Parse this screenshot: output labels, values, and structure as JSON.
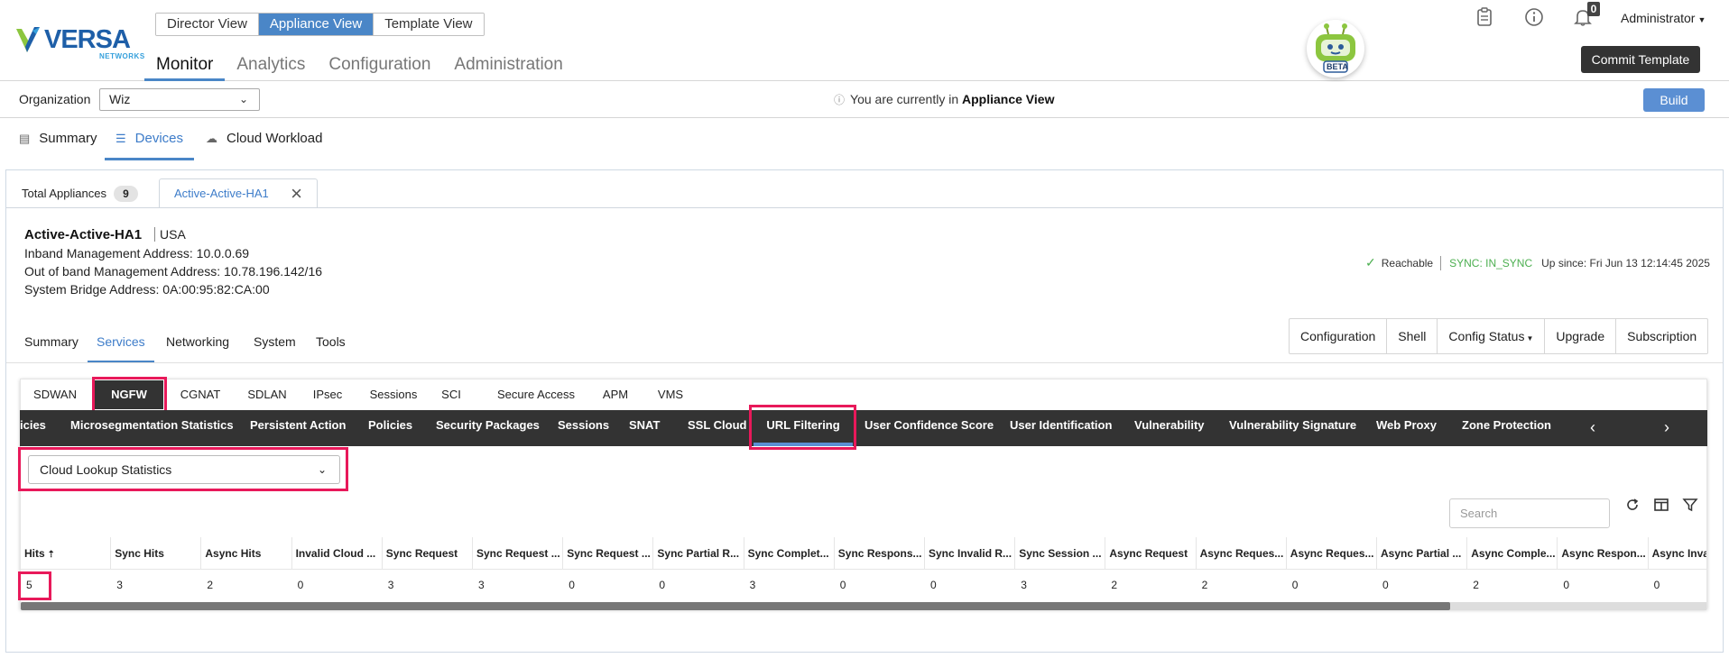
{
  "header": {
    "logo_text": "VERSA",
    "logo_sub": "NETWORKS",
    "view_switch": [
      {
        "label": "Director View",
        "active": false
      },
      {
        "label": "Appliance View",
        "active": true
      },
      {
        "label": "Template View",
        "active": false
      }
    ],
    "main_nav": [
      {
        "label": "Monitor",
        "active": true
      },
      {
        "label": "Analytics",
        "active": false
      },
      {
        "label": "Configuration",
        "active": false
      },
      {
        "label": "Administration",
        "active": false
      }
    ],
    "bot_label": "BETA",
    "notification_count": "0",
    "user": "Administrator",
    "commit_button": "Commit Template"
  },
  "org_bar": {
    "label": "Organization",
    "selected": "Wiz",
    "message_prefix": "You are currently in",
    "message_view": "Appliance View",
    "build_button": "Build"
  },
  "sub_nav": [
    {
      "label": "Summary",
      "icon": "summary-icon",
      "active": false
    },
    {
      "label": "Devices",
      "icon": "devices-icon",
      "active": true
    },
    {
      "label": "Cloud Workload",
      "icon": "cloud-icon",
      "active": false
    }
  ],
  "tabs": {
    "total_label": "Total Appliances",
    "total_count": "9",
    "device_tab": "Active-Active-HA1"
  },
  "device": {
    "name": "Active-Active-HA1",
    "country": "USA",
    "inband": "Inband Management Address: 10.0.0.69",
    "oob": "Out of band Management Address: 10.78.196.142/16",
    "bridge": "System Bridge Address: 0A:00:95:82:CA:00",
    "status": "Reachable",
    "sync": "SYNC: IN_SYNC",
    "uptime": "Up since: Fri Jun 13 12:14:45 2025"
  },
  "service_nav": [
    {
      "label": "Summary",
      "active": false
    },
    {
      "label": "Services",
      "active": true
    },
    {
      "label": "Networking",
      "active": false
    },
    {
      "label": "System",
      "active": false
    },
    {
      "label": "Tools",
      "active": false
    }
  ],
  "actions": [
    "Configuration",
    "Shell",
    "Config Status",
    "Upgrade",
    "Subscription"
  ],
  "categories": [
    {
      "label": "SDWAN",
      "active": false
    },
    {
      "label": "NGFW",
      "active": true
    },
    {
      "label": "CGNAT",
      "active": false
    },
    {
      "label": "SDLAN",
      "active": false
    },
    {
      "label": "IPsec",
      "active": false
    },
    {
      "label": "Sessions",
      "active": false
    },
    {
      "label": "SCI",
      "active": false
    },
    {
      "label": "Secure Access",
      "active": false
    },
    {
      "label": "APM",
      "active": false
    },
    {
      "label": "VMS",
      "active": false
    }
  ],
  "features": [
    {
      "label": "icies",
      "active": false
    },
    {
      "label": "Microsegmentation Statistics",
      "active": false
    },
    {
      "label": "Persistent Action",
      "active": false
    },
    {
      "label": "Policies",
      "active": false
    },
    {
      "label": "Security Packages",
      "active": false
    },
    {
      "label": "Sessions",
      "active": false
    },
    {
      "label": "SNAT",
      "active": false
    },
    {
      "label": "SSL Cloud",
      "active": false
    },
    {
      "label": "URL Filtering",
      "active": true
    },
    {
      "label": "User Confidence Score",
      "active": false
    },
    {
      "label": "User Identification",
      "active": false
    },
    {
      "label": "Vulnerability",
      "active": false
    },
    {
      "label": "Vulnerability Signature",
      "active": false
    },
    {
      "label": "Web Proxy",
      "active": false
    },
    {
      "label": "Zone Protection",
      "active": false
    }
  ],
  "view_select": "Cloud Lookup Statistics",
  "search_placeholder": "Search",
  "table": {
    "columns": [
      "Hits",
      "Sync Hits",
      "Async Hits",
      "Invalid Cloud ...",
      "Sync Request",
      "Sync Request ...",
      "Sync Request ...",
      "Sync Partial R...",
      "Sync Complet...",
      "Sync Respons...",
      "Sync Invalid R...",
      "Sync Session ...",
      "Async Request",
      "Async Reques...",
      "Async Reques...",
      "Async Partial ...",
      "Async Comple...",
      "Async Respon...",
      "Async Inva"
    ],
    "rows": [
      [
        "5",
        "3",
        "2",
        "0",
        "3",
        "3",
        "0",
        "0",
        "3",
        "0",
        "0",
        "3",
        "2",
        "2",
        "0",
        "0",
        "2",
        "0",
        "0"
      ]
    ],
    "sort_column": "Hits"
  }
}
